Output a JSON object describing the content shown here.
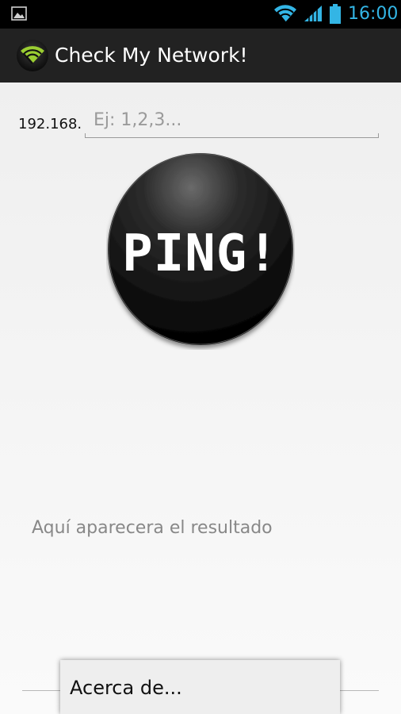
{
  "status_bar": {
    "time": "16:00",
    "icons": [
      "image-notification-icon",
      "wifi-icon",
      "cell-signal-icon",
      "battery-icon"
    ],
    "accent_color": "#33b5e5"
  },
  "action_bar": {
    "app_icon": "wifi-app-icon",
    "title": "Check My Network!"
  },
  "form": {
    "ip_prefix": "192.168.",
    "ip_placeholder": "Ej: 1,2,3...",
    "ip_value": ""
  },
  "ping_button": {
    "label": "PING!"
  },
  "result": {
    "text": "Aquí aparecera el resultado"
  },
  "overflow_menu": {
    "items": [
      {
        "label": "Acerca de..."
      }
    ]
  },
  "colors": {
    "action_bar_bg": "#222222",
    "app_icon_green": "#9acd32",
    "content_bg": "#f2f2f2"
  }
}
